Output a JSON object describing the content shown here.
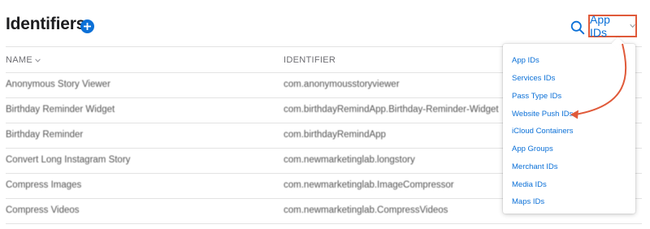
{
  "header": {
    "title": "Identifiers",
    "add_icon": "plus-circle-icon",
    "search_icon": "search-icon",
    "filter_label": "App IDs",
    "filter_icon": "chevron-down-icon"
  },
  "table": {
    "columns": {
      "name": "NAME",
      "identifier": "IDENTIFIER"
    },
    "rows": [
      {
        "name": "Anonymous Story Viewer",
        "identifier": "com.anonymousstoryviewer"
      },
      {
        "name": "Birthday Reminder Widget",
        "identifier": "com.birthdayRemindApp.Birthday-Reminder-Widget"
      },
      {
        "name": "Birthday Reminder",
        "identifier": "com.birthdayRemindApp"
      },
      {
        "name": "Convert Long Instagram Story",
        "identifier": "com.newmarketinglab.longstory"
      },
      {
        "name": "Compress Images",
        "identifier": "com.newmarketinglab.ImageCompressor"
      },
      {
        "name": "Compress Videos",
        "identifier": "com.newmarketinglab.CompressVideos"
      }
    ]
  },
  "dropdown": {
    "items": [
      "App IDs",
      "Services IDs",
      "Pass Type IDs",
      "Website Push IDs",
      "iCloud Containers",
      "App Groups",
      "Merchant IDs",
      "Media IDs",
      "Maps IDs"
    ],
    "highlighted_item": "Website Push IDs"
  },
  "colors": {
    "accent": "#0b70d7",
    "annotation": "#e05a3a",
    "title": "#1d1d1f",
    "muted": "#6e6e73"
  }
}
